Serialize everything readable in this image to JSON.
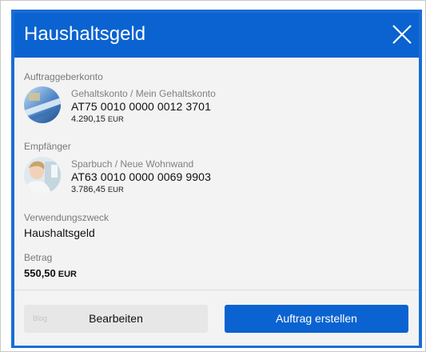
{
  "dialog": {
    "title": "Haushaltsgeld"
  },
  "sender": {
    "section_label": "Auftraggeberkonto",
    "account_name": "Gehaltskonto / Mein Gehaltskonto",
    "iban": "AT75 0010 0000 0012 3701",
    "balance": "4.290,15",
    "currency": "EUR"
  },
  "recipient": {
    "section_label": "Empfänger",
    "account_name": "Sparbuch / Neue Wohnwand",
    "iban": "AT63 0010 0000 0069 9903",
    "balance": "3.786,45",
    "currency": "EUR"
  },
  "purpose": {
    "label": "Verwendungszweck",
    "value": "Haushaltsgeld"
  },
  "amount": {
    "label": "Betrag",
    "value": "550,50",
    "currency": "EUR"
  },
  "footer": {
    "ghost_text": "Blog",
    "edit_label": "Bearbeiten",
    "create_label": "Auftrag erstellen"
  },
  "colors": {
    "brand_blue": "#0a63d0",
    "background": "#f3f3f3"
  },
  "icons": {
    "close": "close-icon",
    "sender_avatar": "card-avatar",
    "recipient_avatar": "person-avatar"
  }
}
